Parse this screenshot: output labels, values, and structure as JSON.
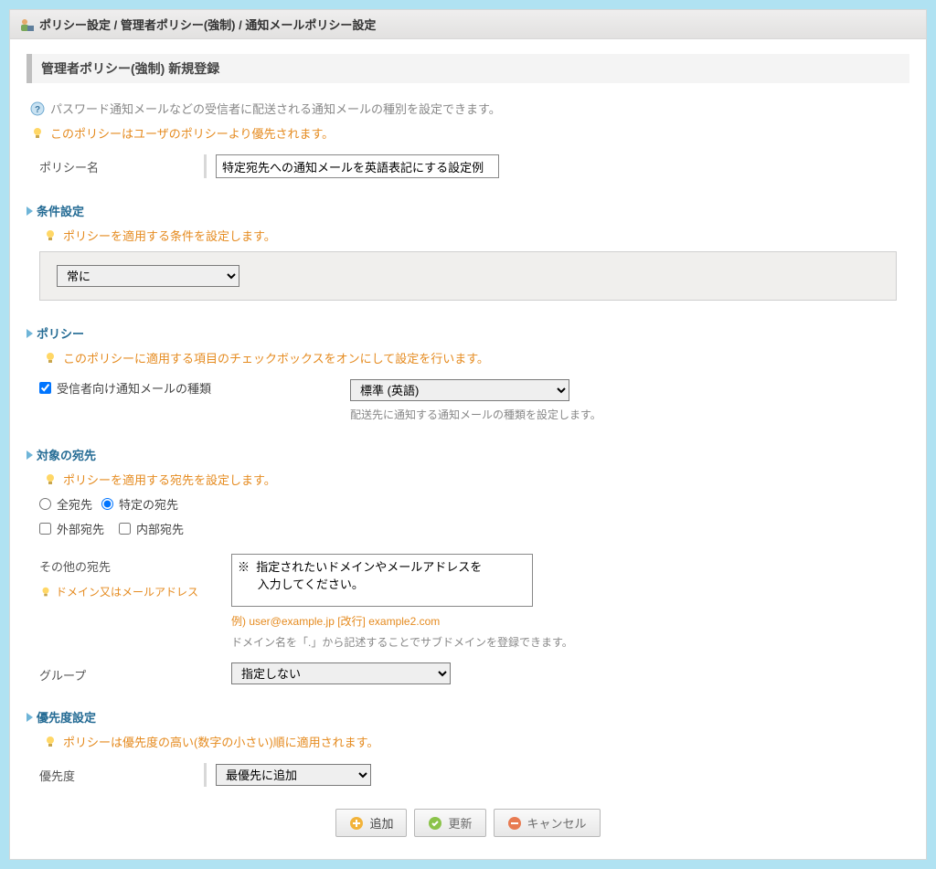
{
  "header": {
    "breadcrumb": "ポリシー設定 / 管理者ポリシー(強制) / 通知メールポリシー設定"
  },
  "page_title": "管理者ポリシー(強制) 新規登録",
  "info_msg": "パスワード通知メールなどの受信者に配送される通知メールの種別を設定できます。",
  "priority_msg": "このポリシーはユーザのポリシーより優先されます。",
  "policy_name": {
    "label": "ポリシー名",
    "value": "特定宛先への通知メールを英語表記にする設定例"
  },
  "sections": {
    "condition": {
      "title": "条件設定",
      "tip": "ポリシーを適用する条件を設定します。",
      "select_value": "常に"
    },
    "policy": {
      "title": "ポリシー",
      "tip": "このポリシーに適用する項目のチェックボックスをオンにして設定を行います。",
      "item_label": "受信者向け通知メールの種類",
      "item_checked": true,
      "select_value": "標準 (英語)",
      "desc": "配送先に通知する通知メールの種類を設定します。"
    },
    "target": {
      "title": "対象の宛先",
      "tip": "ポリシーを適用する宛先を設定します。",
      "radio_all": "全宛先",
      "radio_specific": "特定の宛先",
      "radio_selected": "specific",
      "chk_external": "外部宛先",
      "chk_internal": "内部宛先",
      "other_label": "その他の宛先",
      "domain_hint_label": "ドメイン又はメールアドレス",
      "textarea_value": "※  指定されたいドメインやメールアドレスを\n      入力してください。",
      "example": "例) user@example.jp [改行] example2.com",
      "example_desc": "ドメイン名を「.」から記述することでサブドメインを登録できます。",
      "group_label": "グループ",
      "group_value": "指定しない"
    },
    "priority": {
      "title": "優先度設定",
      "tip": "ポリシーは優先度の高い(数字の小さい)順に適用されます。",
      "label": "優先度",
      "select_value": "最優先に追加"
    }
  },
  "buttons": {
    "add": "追加",
    "update": "更新",
    "cancel": "キャンセル"
  }
}
